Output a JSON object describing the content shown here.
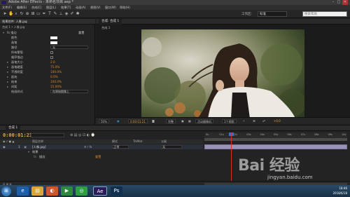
{
  "window": {
    "title": "Adobe After Effects - 未命名项目.aep *"
  },
  "menubar": [
    "文件(F)",
    "编辑(E)",
    "合成(C)",
    "图层(L)",
    "效果(T)",
    "动画(A)",
    "视图(V)",
    "窗口(W)",
    "帮助(H)"
  ],
  "toolbar": {
    "workspace_label": "工作区:",
    "workspace_value": "标准",
    "search_placeholder": "搜索帮助"
  },
  "effects_panel": {
    "tab_label": "效果控件: 人像.jpg",
    "subtitle": "合成 1 • 人像.jpg",
    "rows": [
      {
        "label": "fx 描边",
        "value": "重置",
        "indent": 0,
        "kind": "header"
      },
      {
        "label": "颜色",
        "value": "",
        "indent": 1,
        "kind": "swatch"
      },
      {
        "label": "画笔",
        "value": "",
        "indent": 1,
        "kind": "swatch"
      },
      {
        "label": "路径",
        "value": "无",
        "indent": 1,
        "kind": "dropdown"
      },
      {
        "label": "所有蒙版",
        "value": "",
        "indent": 1,
        "kind": "checkbox"
      },
      {
        "label": "顺序描边",
        "value": "",
        "indent": 1,
        "kind": "checkbox"
      },
      {
        "label": "画笔大小",
        "value": "2.0",
        "indent": 1,
        "kind": "num"
      },
      {
        "label": "画笔硬度",
        "value": "75.0%",
        "indent": 1,
        "kind": "num"
      },
      {
        "label": "不透明度",
        "value": "100.0%",
        "indent": 1,
        "kind": "num"
      },
      {
        "label": "起始",
        "value": "0.0%",
        "indent": 1,
        "kind": "num"
      },
      {
        "label": "结束",
        "value": "100.0%",
        "indent": 1,
        "kind": "num"
      },
      {
        "label": "间距",
        "value": "15.00%",
        "indent": 1,
        "kind": "num"
      },
      {
        "label": "绘画样式",
        "value": "在原始图像上",
        "indent": 1,
        "kind": "dropdown"
      }
    ]
  },
  "comp_panel": {
    "tab_label": "合成: 合成 1",
    "subtab": "合成 1",
    "zoom": "50%",
    "timecode": "0:00:01:21",
    "quality": "完整",
    "camera": "活动摄像机",
    "views": "1个视图",
    "exposure": "+0.0"
  },
  "timeline": {
    "tab_label": "合成 1",
    "timecode": "0:00:01:21",
    "search_placeholder": "",
    "col_layer": "图层名称",
    "col_mode": "模式",
    "col_trkmat": "TrkMat",
    "col_parent": "父级",
    "layers": [
      {
        "index": "1",
        "name": "[人像.jpg]",
        "mode": "正常",
        "parent": "无"
      }
    ],
    "sub_rows": [
      {
        "label": "效果",
        "value": ""
      },
      {
        "label": "描边",
        "value": "重置"
      }
    ],
    "ruler_ticks": [
      "0s",
      "01s",
      "02s",
      "03s",
      "04s",
      "05s",
      "06s",
      "07s",
      "08s",
      "09s",
      "10s"
    ]
  },
  "taskbar": {
    "apps": [
      "start",
      "ie",
      "explorer",
      "firefox",
      "media",
      "chrome",
      "after-effects",
      "photoshop"
    ],
    "clock_time": "18:46",
    "clock_date": "2018/6/18"
  },
  "watermark": {
    "logo": "Bai 经验",
    "url": "jingyan.baidu.com"
  },
  "colors": {
    "accent_orange": "#d88a2a",
    "layer_bar": "#9993b8",
    "playhead": "#cc3333"
  }
}
